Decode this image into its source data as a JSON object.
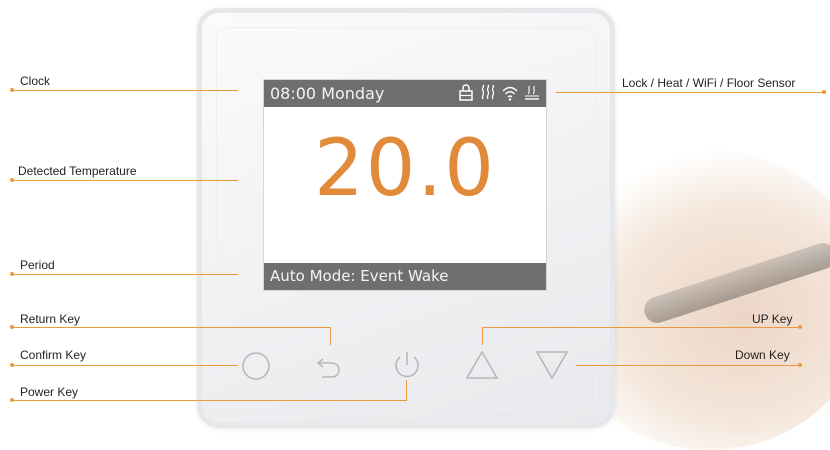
{
  "screen": {
    "clock": "08:00 Monday",
    "temperature": "20.0",
    "mode": "Auto Mode: Event Wake",
    "status_icons": [
      "lock-icon",
      "heat-icon",
      "wifi-icon",
      "floor-sensor-icon"
    ]
  },
  "keys": [
    "confirm-key",
    "return-key",
    "power-key",
    "up-key",
    "down-key"
  ],
  "labels": {
    "clock": "Clock",
    "detected_temperature": "Detected Temperature",
    "period": "Period",
    "return_key": "Return Key",
    "confirm_key": "Confirm Key",
    "power_key": "Power Key",
    "status_icons": "Lock / Heat / WiFi / Floor Sensor",
    "up_key": "UP Key",
    "down_key": "Down Key"
  },
  "colors": {
    "accent": "#e89a3e",
    "temperature": "#e08a3a",
    "status_bar": "#6f6f6f"
  }
}
